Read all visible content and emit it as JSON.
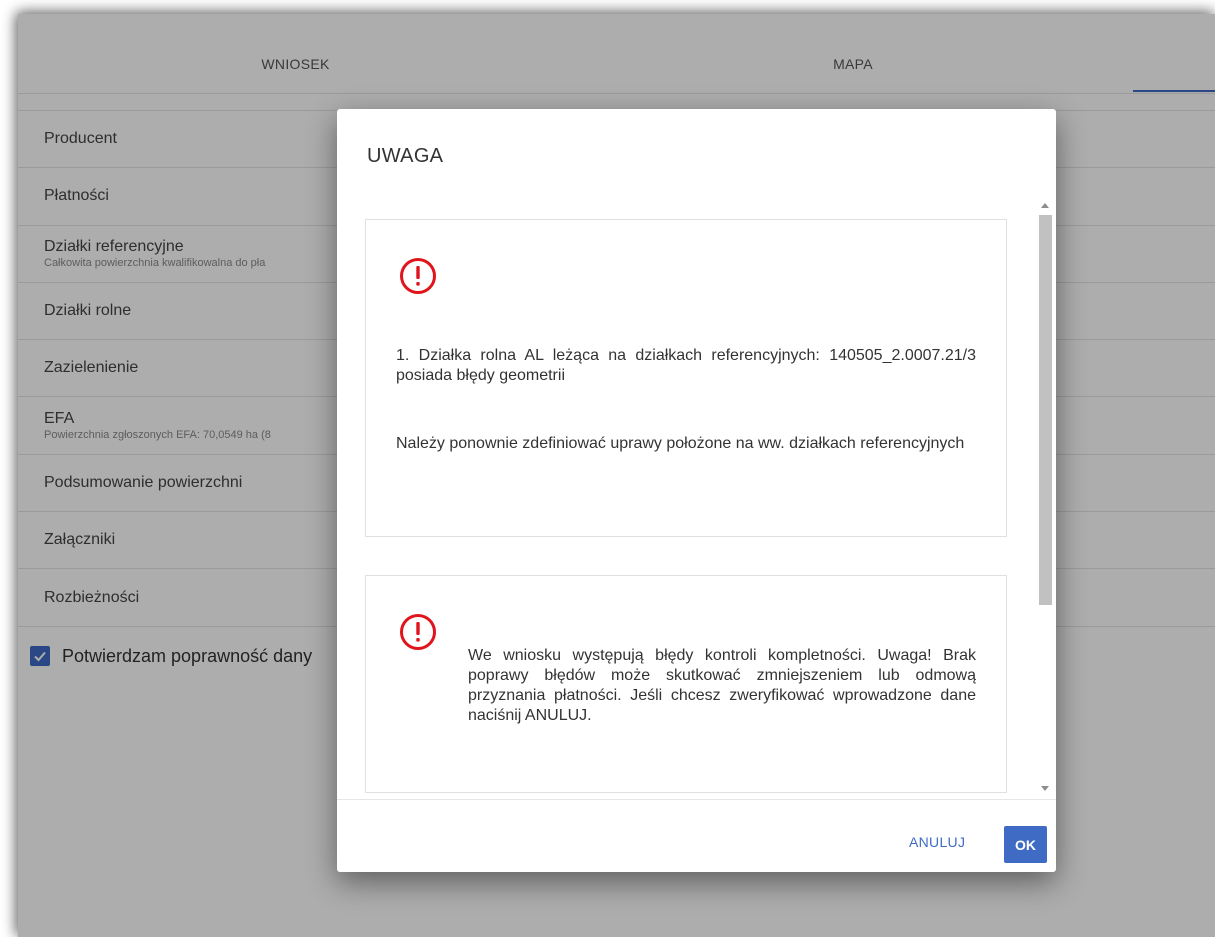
{
  "tabs": [
    {
      "label": "WNIOSEK"
    },
    {
      "label": "MAPA"
    },
    {
      "label": ""
    }
  ],
  "sections": [
    {
      "title": "Producent",
      "subtitle": ""
    },
    {
      "title": "Płatności",
      "subtitle": ""
    },
    {
      "title": "Działki referencyjne",
      "subtitle": "Całkowita powierzchnia kwalifikowalna do pła"
    },
    {
      "title": "Działki rolne",
      "subtitle": ""
    },
    {
      "title": "Zazielenienie",
      "subtitle": ""
    },
    {
      "title": "EFA",
      "subtitle": "Powierzchnia zgłoszonych EFA: 70,0549 ha (8"
    },
    {
      "title": "Podsumowanie powierzchni",
      "subtitle": ""
    },
    {
      "title": "Załączniki",
      "subtitle": ""
    },
    {
      "title": "Rozbieżności",
      "subtitle": ""
    }
  ],
  "confirm": {
    "label": "Potwierdzam poprawność dany",
    "checked": true
  },
  "dialog": {
    "title": "UWAGA",
    "messages": [
      {
        "paragraphs": [
          "1. Działka rolna AL leżąca na działkach referencyjnych: 140505_2.0007.21/3 posiada błędy geometrii",
          "Należy ponownie zdefiniować uprawy położone na ww. działkach referencyjnych"
        ]
      },
      {
        "paragraphs": [
          "We wniosku występują błędy kontroli kompletności. Uwaga! Brak poprawy błędów może skutkować zmniejszeniem lub odmową przyznania płatności. Jeśli chcesz zweryfikować wprowadzone dane naciśnij ANULUJ."
        ]
      }
    ],
    "cancel_label": "ANULUJ",
    "ok_label": "OK"
  },
  "colors": {
    "accent": "#3f6bc5",
    "warning": "#e0151b"
  },
  "icons": {
    "warning": "exclamation-circle-icon",
    "check": "checkmark-icon"
  }
}
